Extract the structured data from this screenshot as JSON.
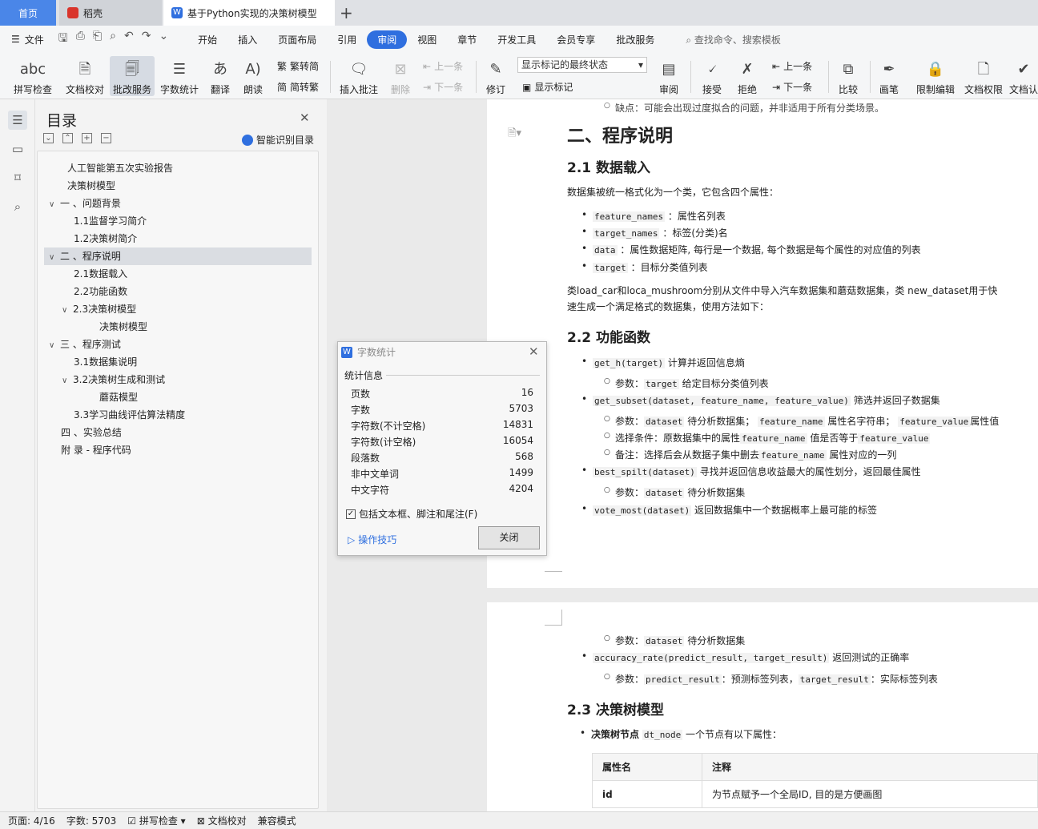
{
  "tabs": {
    "home": "首页",
    "daoke": "稻壳",
    "doc": "基于Python实现的决策树模型",
    "add": "+"
  },
  "menubar": {
    "file": "文件",
    "items": [
      "开始",
      "插入",
      "页面布局",
      "引用",
      "审阅",
      "视图",
      "章节",
      "开发工具",
      "会员专享",
      "批改服务"
    ],
    "active": "审阅",
    "search": "查找命令、搜索模板"
  },
  "ribbon": {
    "spell": "拼写检查",
    "proof": "文档校对",
    "grade": "批改服务",
    "wordcount": "字数统计",
    "translate": "翻译",
    "read": "朗读",
    "trad": "繁转简",
    "simp": "简转繁",
    "insert_comment": "插入批注",
    "delete": "删除",
    "prev1": "上一条",
    "next1": "下一条",
    "revise": "修订",
    "combo": "显示标记的最终状态",
    "show_mark": "显示标记",
    "review": "审阅",
    "accept": "接受",
    "reject": "拒绝",
    "prev2": "上一条",
    "next2": "下一条",
    "compare": "比较",
    "pen": "画笔",
    "restrict": "限制编辑",
    "perm": "文档权限",
    "auth": "文档认"
  },
  "toc": {
    "title": "目录",
    "smart": "智能识别目录",
    "items": [
      "人工智能第五次实验报告",
      "决策树模型",
      "一 、问题背景",
      "1.1监督学习简介",
      "1.2决策树简介",
      "二 、程序说明",
      "2.1数据载入",
      "2.2功能函数",
      "2.3决策树模型",
      "决策树模型",
      "三 、程序测试",
      "3.1数据集说明",
      "3.2决策树生成和测试",
      "蘑菇模型",
      "3.3学习曲线评估算法精度",
      "四 、实验总结",
      "附 录 - 程序代码"
    ]
  },
  "doc": {
    "top_cut": "缺点：可能会出现过度拟合的问题，并非适用于所有分类场景。",
    "h_section": "二、程序说明",
    "h21": "2.1 数据载入",
    "p21": "数据集被统一格式化为一个类，它包含四个属性：",
    "attrs": [
      {
        "code": "feature_names",
        "text": "：属性名列表"
      },
      {
        "code": "target_names",
        "text": "：标签(分类)名"
      },
      {
        "code": "data",
        "text": "：属性数据矩阵, 每行是一个数据, 每个数据是每个属性的对应值的列表"
      },
      {
        "code": "target",
        "text": "：目标分类值列表"
      }
    ],
    "p_load1": "类load_car和loca_mushroom分别从文件中导入汽车数据集和蘑菇数据集，类 new_dataset用于快",
    "p_load2": "速生成一个满足格式的数据集，使用方法如下：",
    "h22": "2.2 功能函数",
    "f1": "get_h(target)",
    "f1t": "计算并返回信息熵",
    "f1p": "参数：",
    "f1pc": "target",
    "f1pt": "给定目标分类值列表",
    "f2": "get_subset(dataset, feature_name, feature_value)",
    "f2t": "筛选并返回子数据集",
    "f2p1a": "参数：",
    "f2p1b": "dataset",
    "f2p1c": "待分析数据集；",
    "f2p1d": "feature_name",
    "f2p1e": "属性名字符串；",
    "f2p1f": "feature_value",
    "f2p1g": "属性值",
    "f2p2a": "选择条件：原数据集中的属性",
    "f2p2b": "feature_name",
    "f2p2c": "值是否等于",
    "f2p2d": "feature_value",
    "f2p3a": "备注：选择后会从数据子集中删去",
    "f2p3b": "feature_name",
    "f2p3c": "属性对应的一列",
    "f3": "best_spilt(dataset)",
    "f3t": "寻找并返回信息收益最大的属性划分，返回最佳属性",
    "f3p": "参数：",
    "f3pc": "dataset",
    "f3pt": "待分析数据集",
    "f4": "vote_most(dataset)",
    "f4t": "返回数据集中一个数据概率上最可能的标签",
    "p2_a": "参数：",
    "p2_b": "dataset",
    "p2_c": "待分析数据集",
    "f5": "accuracy_rate(predict_result, target_result)",
    "f5t": "返回测试的正确率",
    "f5p": "参数：",
    "f5pc1": "predict_result",
    "f5pt1": "：预测标签列表，",
    "f5pc2": "target_result",
    "f5pt2": "：实际标签列表",
    "h23": "2.3 决策树模型",
    "node_a": "决策树节点",
    "node_b": "dt_node",
    "node_c": "一个节点有以下属性：",
    "th1": "属性名",
    "th2": "注释",
    "td1": "id",
    "td2": "为节点赋予一个全局ID, 目的是方便画图"
  },
  "dialog": {
    "title": "字数统计",
    "section": "统计信息",
    "rows": [
      {
        "label": "页数",
        "value": "16"
      },
      {
        "label": "字数",
        "value": "5703"
      },
      {
        "label": "字符数(不计空格)",
        "value": "14831"
      },
      {
        "label": "字符数(计空格)",
        "value": "16054"
      },
      {
        "label": "段落数",
        "value": "568"
      },
      {
        "label": "非中文单词",
        "value": "1499"
      },
      {
        "label": "中文字符",
        "value": "4204"
      }
    ],
    "checkbox": "包括文本框、脚注和尾注(F)",
    "tips": "操作技巧",
    "close": "关闭"
  },
  "status": {
    "page": "页面: 4/16",
    "words": "字数: 5703",
    "spell": "拼写检查",
    "proof": "文档校对",
    "compat": "兼容模式"
  }
}
